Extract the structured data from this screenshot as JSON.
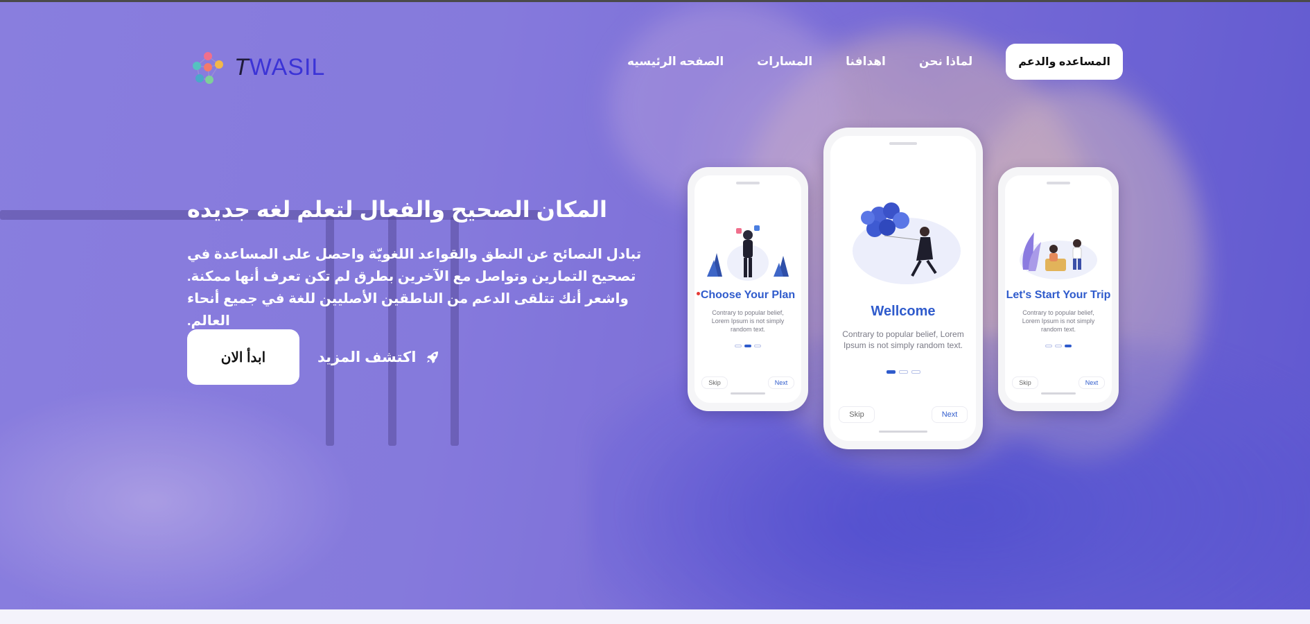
{
  "nav": {
    "brand_first": "T",
    "brand_rest": "WASIL",
    "items": [
      "الصفحه الرئيسيه",
      "المسارات",
      "اهدافنا",
      "لماذا نحن"
    ],
    "help_button": "المساعده والدعم"
  },
  "hero": {
    "title": "المكان الصحيح والفعال لتعلم لغه جديده",
    "description": "تبادل النصائح عن النطق والقواعد اللغويّة واحصل على المساعدة في تصحيح التمارين وتواصل مع الآخرين بطرق لم تكن تعرف أنها ممكنة. واشعر أنك تتلقى الدعم من الناطقين الأصليين للغة في جميع أنحاء العالم.",
    "start_button": "ابدأ الان",
    "explore_link": "اكتشف المزيد"
  },
  "phones": [
    {
      "title": "Choose Your Plan",
      "text": "Contrary to popular belief, Lorem Ipsum is not simply random text.",
      "active_dot": 1,
      "skip": "Skip",
      "next": "Next"
    },
    {
      "title": "Wellcome",
      "text": "Contrary to popular belief, Lorem Ipsum is not simply random text.",
      "active_dot": 0,
      "skip": "Skip",
      "next": "Next"
    },
    {
      "title": "Let's Start Your Trip",
      "text": "Contrary to popular belief, Lorem Ipsum is not simply random text.",
      "active_dot": 2,
      "skip": "Skip",
      "next": "Next"
    }
  ],
  "colors": {
    "overlay": "#8a7fdc",
    "accent": "#2f5bcc",
    "brand": "#3b33d6"
  },
  "icons": [
    "logo-molecule-icon",
    "rocket-icon"
  ]
}
